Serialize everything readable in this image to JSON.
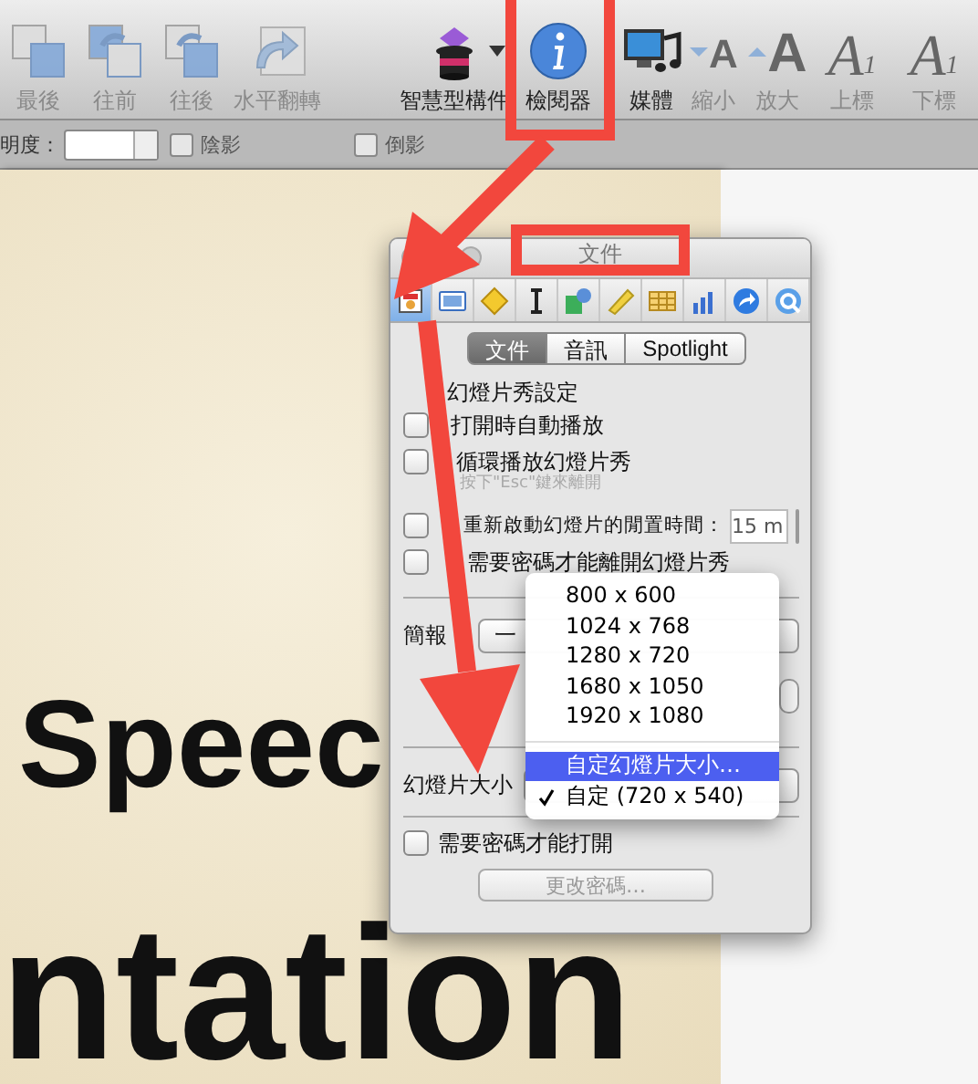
{
  "toolbar": {
    "items": [
      {
        "label": "最後",
        "disabled": true
      },
      {
        "label": "往前",
        "disabled": true
      },
      {
        "label": "往後",
        "disabled": true
      },
      {
        "label": "水平翻轉",
        "disabled": true
      },
      {
        "label": "智慧型構件",
        "disabled": false,
        "menu": true
      },
      {
        "label": "檢閱器",
        "disabled": false
      },
      {
        "label": "媒體",
        "disabled": false
      },
      {
        "label": "縮小",
        "glyph": "A",
        "disabled": true
      },
      {
        "label": "放大",
        "glyph": "A",
        "disabled": true
      },
      {
        "label": "上標",
        "glyph": "A",
        "index": "1",
        "disabled": true
      },
      {
        "label": "下標",
        "glyph": "A",
        "index": "1",
        "disabled": true
      }
    ]
  },
  "format_bar": {
    "opacity_label": "明度：",
    "shadow": {
      "label": "陰影",
      "checked": false
    },
    "reflection": {
      "label": "倒影",
      "checked": false
    }
  },
  "slide": {
    "lines": [
      "Speec",
      "ntation"
    ]
  },
  "inspector": {
    "title": "文件",
    "tool_tabs": [
      {
        "kind": "document",
        "selected": true
      },
      {
        "kind": "slide",
        "selected": false
      },
      {
        "kind": "transition",
        "selected": false
      },
      {
        "kind": "text",
        "selected": false
      },
      {
        "kind": "shape",
        "selected": false
      },
      {
        "kind": "metrics",
        "selected": false
      },
      {
        "kind": "table",
        "selected": false
      },
      {
        "kind": "chart",
        "selected": false
      },
      {
        "kind": "link",
        "selected": false
      },
      {
        "kind": "quicktime",
        "selected": false
      }
    ],
    "segments": [
      {
        "label": "文件",
        "selected": true
      },
      {
        "label": "音訊",
        "selected": false
      },
      {
        "label": "Spotlight",
        "selected": false
      }
    ],
    "section_title": "幻燈片秀設定",
    "autoplay": {
      "label": "打開時自動播放",
      "checked": false
    },
    "loop": {
      "label": "循環播放幻燈片秀",
      "checked": false,
      "hint": "按下\"Esc\"鍵來離開"
    },
    "idle_restart": {
      "label": "重新啟動幻燈片的閒置時間：",
      "checked": false,
      "value": "15 m"
    },
    "exit_password": {
      "label": "需要密碼才能離開幻燈片秀",
      "checked": false
    },
    "presentation": {
      "label": "簡報",
      "value": "一"
    },
    "slide_size": {
      "label": "幻燈片大小"
    },
    "open_password": {
      "label": "需要密碼才能打開",
      "checked": false
    },
    "change_password": {
      "label": "更改密碼…",
      "disabled": true
    }
  },
  "menu": {
    "items": [
      {
        "kind": "option",
        "label": "800 x 600",
        "checked": false,
        "highlighted": false
      },
      {
        "kind": "option",
        "label": "1024 x 768",
        "checked": false,
        "highlighted": false
      },
      {
        "kind": "option",
        "label": "1280 x 720",
        "checked": false,
        "highlighted": false
      },
      {
        "kind": "option",
        "label": "1680 x 1050",
        "checked": false,
        "highlighted": false
      },
      {
        "kind": "option",
        "label": "1920 x 1080",
        "checked": false,
        "highlighted": false
      },
      {
        "kind": "separator"
      },
      {
        "kind": "option",
        "label": "自定幻燈片大小…",
        "checked": false,
        "highlighted": true
      },
      {
        "kind": "option",
        "label": "自定 (720 x 540)",
        "checked": true,
        "highlighted": false
      }
    ]
  }
}
